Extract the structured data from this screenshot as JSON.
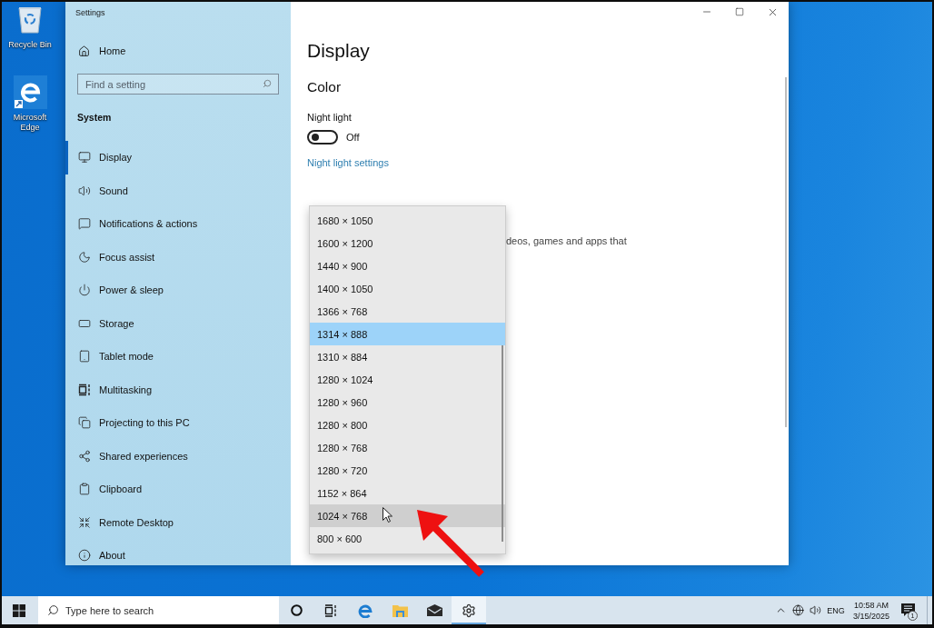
{
  "desktop": {
    "shortcuts": [
      {
        "label": "Recycle Bin"
      },
      {
        "label": "Microsoft Edge"
      }
    ]
  },
  "window": {
    "title": "Settings"
  },
  "sidebar": {
    "home": "Home",
    "search": {
      "placeholder": "Find a setting"
    },
    "section": "System",
    "items": [
      {
        "label": "Display",
        "selected": true
      },
      {
        "label": "Sound",
        "selected": false
      },
      {
        "label": "Notifications & actions",
        "selected": false
      },
      {
        "label": "Focus assist",
        "selected": false
      },
      {
        "label": "Power & sleep",
        "selected": false
      },
      {
        "label": "Storage",
        "selected": false
      },
      {
        "label": "Tablet mode",
        "selected": false
      },
      {
        "label": "Multitasking",
        "selected": false
      },
      {
        "label": "Projecting to this PC",
        "selected": false
      },
      {
        "label": "Shared experiences",
        "selected": false
      },
      {
        "label": "Clipboard",
        "selected": false
      },
      {
        "label": "Remote Desktop",
        "selected": false
      },
      {
        "label": "About",
        "selected": false
      }
    ]
  },
  "main": {
    "title": "Display",
    "section": "Color",
    "night_light": {
      "label": "Night light",
      "on": false,
      "state": "Off"
    },
    "link": "Night light settings",
    "partial_text": "deos, games and apps that"
  },
  "dropdown": {
    "options": [
      {
        "label": "1680 × 1050",
        "selected": false,
        "hovered": false
      },
      {
        "label": "1600 × 1200",
        "selected": false,
        "hovered": false
      },
      {
        "label": "1440 × 900",
        "selected": false,
        "hovered": false
      },
      {
        "label": "1400 × 1050",
        "selected": false,
        "hovered": false
      },
      {
        "label": "1366 × 768",
        "selected": false,
        "hovered": false
      },
      {
        "label": "1314 × 888",
        "selected": true,
        "hovered": false
      },
      {
        "label": "1310 × 884",
        "selected": false,
        "hovered": false
      },
      {
        "label": "1280 × 1024",
        "selected": false,
        "hovered": false
      },
      {
        "label": "1280 × 960",
        "selected": false,
        "hovered": false
      },
      {
        "label": "1280 × 800",
        "selected": false,
        "hovered": false
      },
      {
        "label": "1280 × 768",
        "selected": false,
        "hovered": false
      },
      {
        "label": "1280 × 720",
        "selected": false,
        "hovered": false
      },
      {
        "label": "1152 × 864",
        "selected": false,
        "hovered": false
      },
      {
        "label": "1024 × 768",
        "selected": false,
        "hovered": true
      },
      {
        "label": "800 × 600",
        "selected": false,
        "hovered": false
      }
    ]
  },
  "taskbar": {
    "search": {
      "placeholder": "Type here to search"
    },
    "buttons": [
      {
        "selected": false
      },
      {
        "selected": false
      },
      {
        "selected": false
      },
      {
        "selected": false
      },
      {
        "selected": false
      },
      {
        "selected": true
      }
    ],
    "tray": {
      "language": "ENG",
      "time": "10:58 AM",
      "date": "3/15/2025",
      "notifications": "1"
    }
  }
}
